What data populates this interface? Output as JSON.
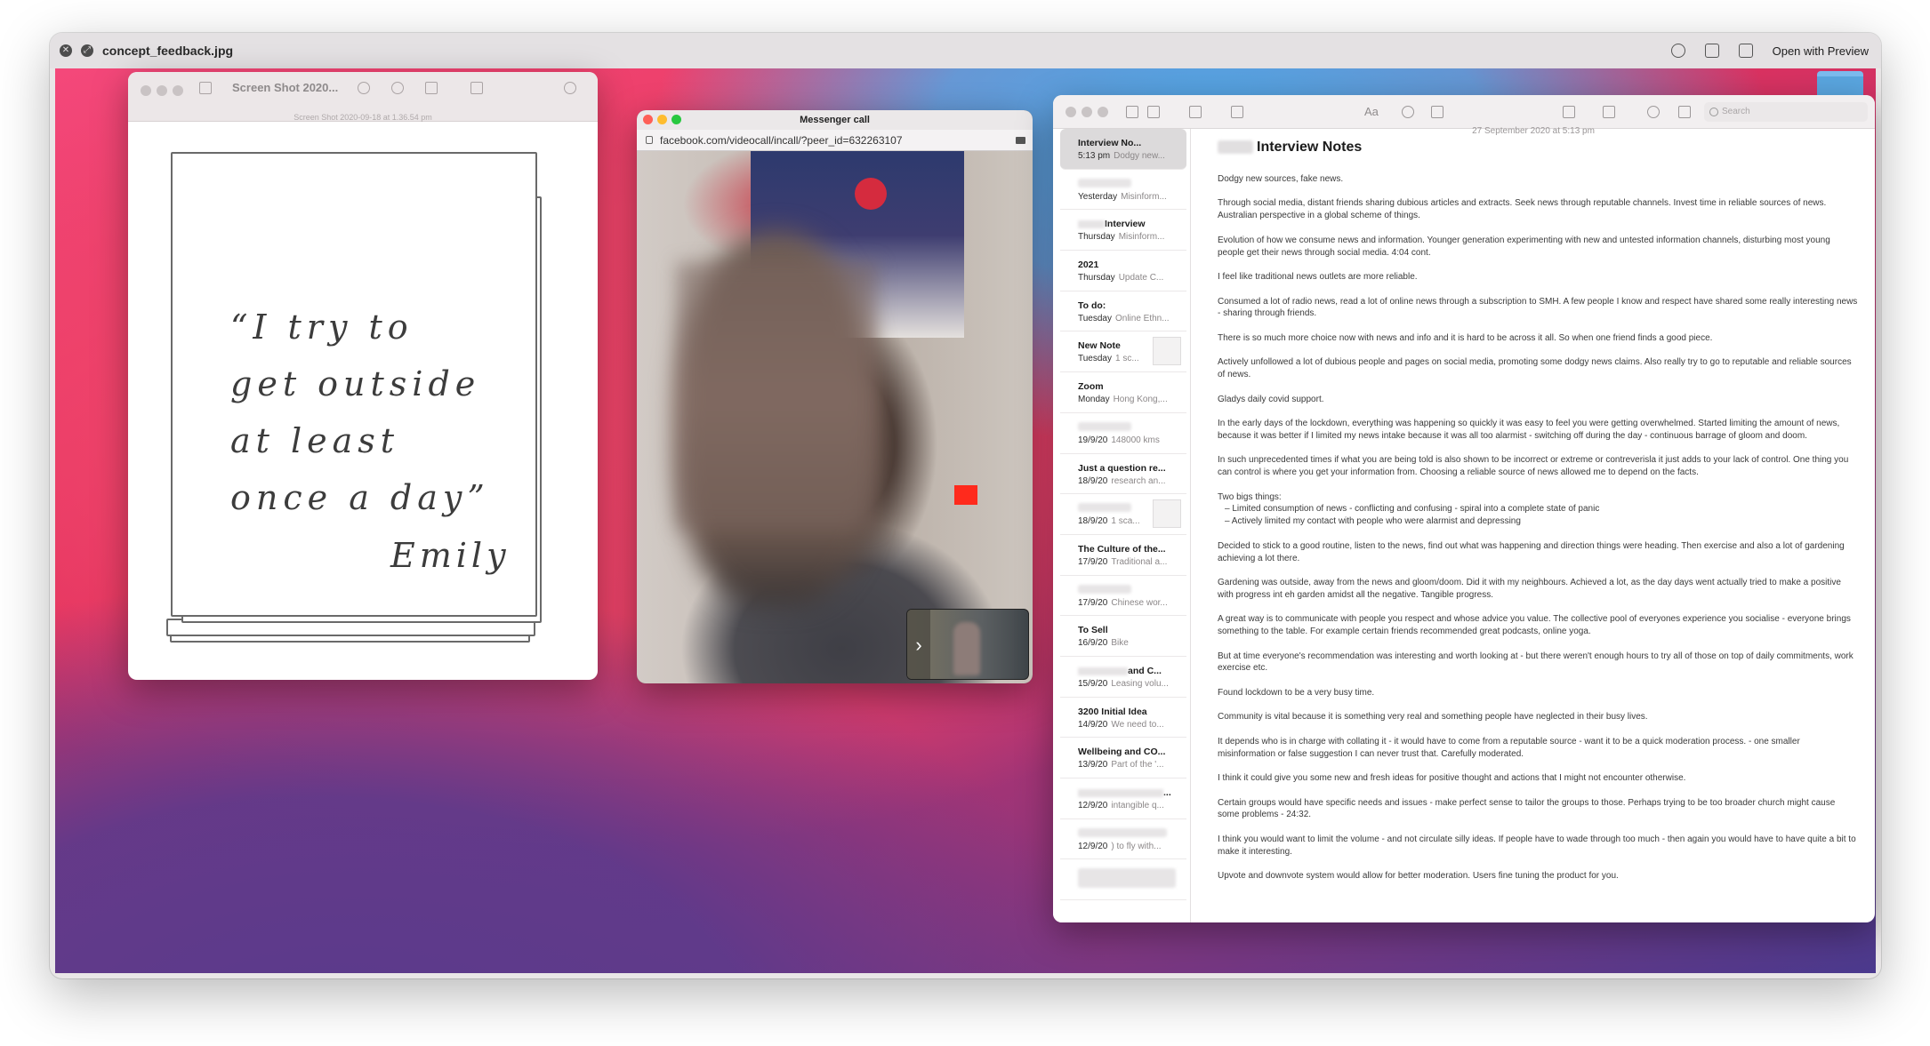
{
  "quicklook": {
    "filename": "concept_feedback.jpg",
    "open_with": "Open with Preview"
  },
  "preview_window": {
    "title": "Screen Shot 2020...",
    "subtitle": "Screen Shot 2020-09-18 at 1.36.54 pm",
    "quote_lines": [
      "“I try to",
      "get outside",
      "at least",
      "once a day”"
    ],
    "signature": "Emily"
  },
  "messenger": {
    "title": "Messenger call",
    "url": "facebook.com/videocall/incall/?peer_id=632263107",
    "pip_chevron": "›"
  },
  "notes": {
    "search_placeholder": "Search",
    "font_label": "Aa",
    "list": [
      {
        "title": "Interview No...",
        "date": "5:13 pm",
        "preview": "Dodgy new..."
      },
      {
        "title": "",
        "date": "Yesterday",
        "preview": "Misinform..."
      },
      {
        "title": "Interview",
        "date": "Thursday",
        "preview": "Misinform..."
      },
      {
        "title": "2021",
        "date": "Thursday",
        "preview": "Update C..."
      },
      {
        "title": "To do:",
        "date": "Tuesday",
        "preview": "Online Ethn..."
      },
      {
        "title": "New Note",
        "date": "Tuesday",
        "preview": "1 sc..."
      },
      {
        "title": "Zoom",
        "date": "Monday",
        "preview": "Hong Kong,..."
      },
      {
        "title": "",
        "date": "19/9/20",
        "preview": "148000 kms"
      },
      {
        "title": "Just a question re...",
        "date": "18/9/20",
        "preview": "research an..."
      },
      {
        "title": "",
        "date": "18/9/20",
        "preview": "1 sca..."
      },
      {
        "title": "The Culture of the...",
        "date": "17/9/20",
        "preview": "Traditional a..."
      },
      {
        "title": "",
        "date": "17/9/20",
        "preview": "Chinese wor..."
      },
      {
        "title": "To Sell",
        "date": "16/9/20",
        "preview": "Bike"
      },
      {
        "title": "and C...",
        "date": "15/9/20",
        "preview": "Leasing volu..."
      },
      {
        "title": "3200 Initial Idea",
        "date": "14/9/20",
        "preview": "We need to..."
      },
      {
        "title": "Wellbeing and CO...",
        "date": "13/9/20",
        "preview": "Part of the '..."
      },
      {
        "title": "...",
        "date": "12/9/20",
        "preview": "intangible q..."
      },
      {
        "title": "",
        "date": "12/9/20",
        "preview": ") to fly with..."
      }
    ],
    "note_date": "27 September 2020 at 5:13 pm",
    "note_title": "Interview Notes",
    "paragraphs": [
      "Dodgy new sources, fake news.",
      "Through social media, distant friends sharing dubious articles and extracts. Seek news through reputable channels. Invest time in reliable sources of news. Australian perspective in a global scheme of things.",
      "Evolution of how we consume news and information. Younger generation experimenting with new and untested information channels, disturbing most young people get their news through social media. 4:04 cont.",
      "I feel like traditional news outlets are more reliable.",
      "Consumed a lot of radio news, read a lot of online news through a subscription to SMH. A few people I know  and respect have shared some really interesting news - sharing through friends.",
      "There is so much more choice now with news and info and it is hard to be across it all. So when one friend finds a good piece.",
      "Actively unfollowed a lot of dubious people and pages on social media, promoting some dodgy news claims. Also really try to go to reputable and reliable sources of news.",
      "Gladys daily covid support.",
      "In the early days of the lockdown, everything was happening so quickly it was easy to feel you were getting overwhelmed. Started limiting the amount of news, because it was better if I limited my news intake because it was all too alarmist - switching off during the day - continuous barrage of gloom and doom.",
      "In such unprecedented times if what you are being told is also shown to be incorrect or extreme or contreverisla it just adds to your lack of control. One thing you can control is where you get your information from. Choosing a reliable source of news allowed me to depend on the facts."
    ],
    "list_heading": "Two bigs things:",
    "list_items": [
      "–  Limited consumption of news - conflicting and confusing - spiral into a complete state of panic",
      "–  Actively limited my contact with people who were alarmist and depressing"
    ],
    "paragraphs2": [
      "Decided to stick to a good routine, listen to the news, find out what was happening and direction things were heading. Then exercise and also a lot of gardening achieving a lot there.",
      "Gardening was outside, away from the news and gloom/doom. Did it with my neighbours. Achieved a lot, as the day days went actually tried to make a positive with progress int eh garden amidst all the negative. Tangible progress.",
      "A great way is to communicate with people you respect and whose advice you value. The collective pool of everyones experience you socialise - everyone brings something to the table. For example certain friends recommended great podcasts, online yoga.",
      "But at time everyone's recommendation was interesting and worth looking at - but there weren't enough hours to try all of those on top of daily commitments, work exercise etc.",
      "Found lockdown to be a very busy time.",
      "Community is vital because it is something very real and something people have neglected in their busy lives.",
      "It depends who is in charge with collating it - it would have to come from a reputable source - want it to be a quick moderation process. - one smaller misinformation or false suggestion I can never trust that. Carefully moderated.",
      "I think it could give you some new and fresh ideas for positive thought and actions that I might not encounter otherwise.",
      "Certain groups would have specific needs and issues - make perfect sense to tailor the groups to those. Perhaps trying to be too broader church might cause some problems - 24:32.",
      "I think you would want to limit the volume - and not circulate silly ideas. If people have to wade through too much - then again you would have to have quite a bit to make it interesting.",
      "Upvote and downvote system would allow for better moderation. Users fine tuning the product for you."
    ]
  },
  "colors": {
    "desktop_pink": "#f0456a",
    "desktop_blue": "#4fa8e8",
    "desktop_purple": "#5a3a8c",
    "traffic_red": "#fe5f57",
    "traffic_yellow": "#febc2e",
    "traffic_green": "#28c840"
  }
}
